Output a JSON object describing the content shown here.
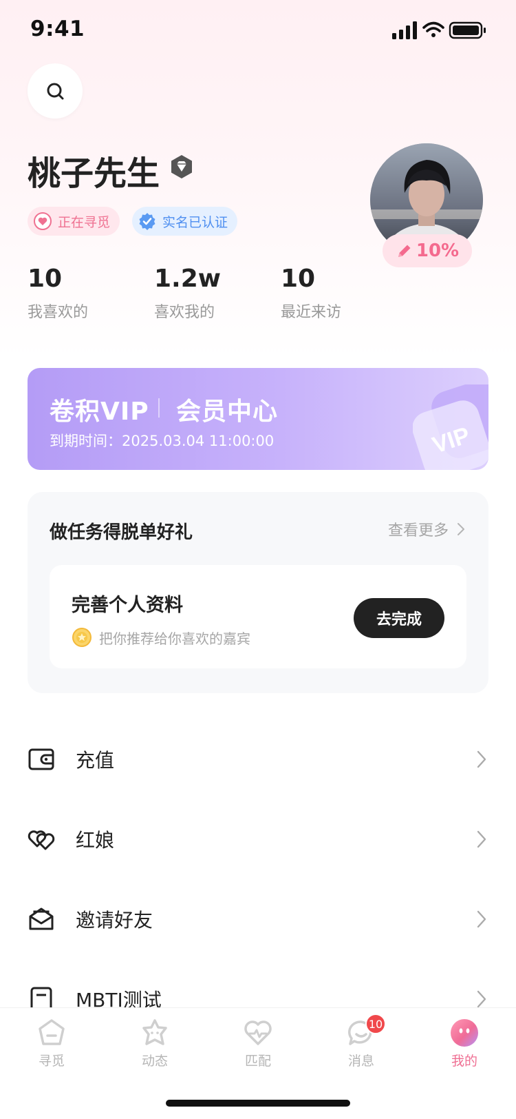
{
  "status_bar": {
    "time": "9:41"
  },
  "profile": {
    "name": "桃子先生",
    "badges": {
      "seeking": "正在寻觅",
      "verified": "实名已认证"
    },
    "profile_completion": "10%",
    "profile_completion_value": 0.1
  },
  "stats": [
    {
      "value": "10",
      "label": "我喜欢的"
    },
    {
      "value": "1.2w",
      "label": "喜欢我的"
    },
    {
      "value": "10",
      "label": "最近来访"
    }
  ],
  "vip": {
    "title": "卷积VIP",
    "center": "会员中心",
    "expire_label": "到期时间：",
    "expire_value": "2025.03.04 11:00:00",
    "deco_text": "VIP"
  },
  "tasks": {
    "title": "做任务得脱单好礼",
    "more": "查看更多",
    "item": {
      "title": "完善个人资料",
      "subtitle": "把你推荐给你喜欢的嘉宾",
      "button": "去完成"
    }
  },
  "menu": [
    {
      "label": "充值",
      "icon": "wallet-icon"
    },
    {
      "label": "红娘",
      "icon": "hearts-icon"
    },
    {
      "label": "邀请好友",
      "icon": "envelope-icon"
    },
    {
      "label": "MBTI测试",
      "icon": "test-icon"
    }
  ],
  "tabbar": {
    "items": [
      {
        "label": "寻觅",
        "icon": "home-icon"
      },
      {
        "label": "动态",
        "icon": "moments-icon"
      },
      {
        "label": "匹配",
        "icon": "match-icon"
      },
      {
        "label": "消息",
        "icon": "message-icon",
        "badge": "10"
      },
      {
        "label": "我的",
        "icon": "profile-icon",
        "active": true
      }
    ]
  },
  "colors": {
    "accent_pink": "#ef6f93",
    "vip_purple": "#b49cf6",
    "verified_blue": "#4f8ff0",
    "badge_red": "#f0484b"
  }
}
